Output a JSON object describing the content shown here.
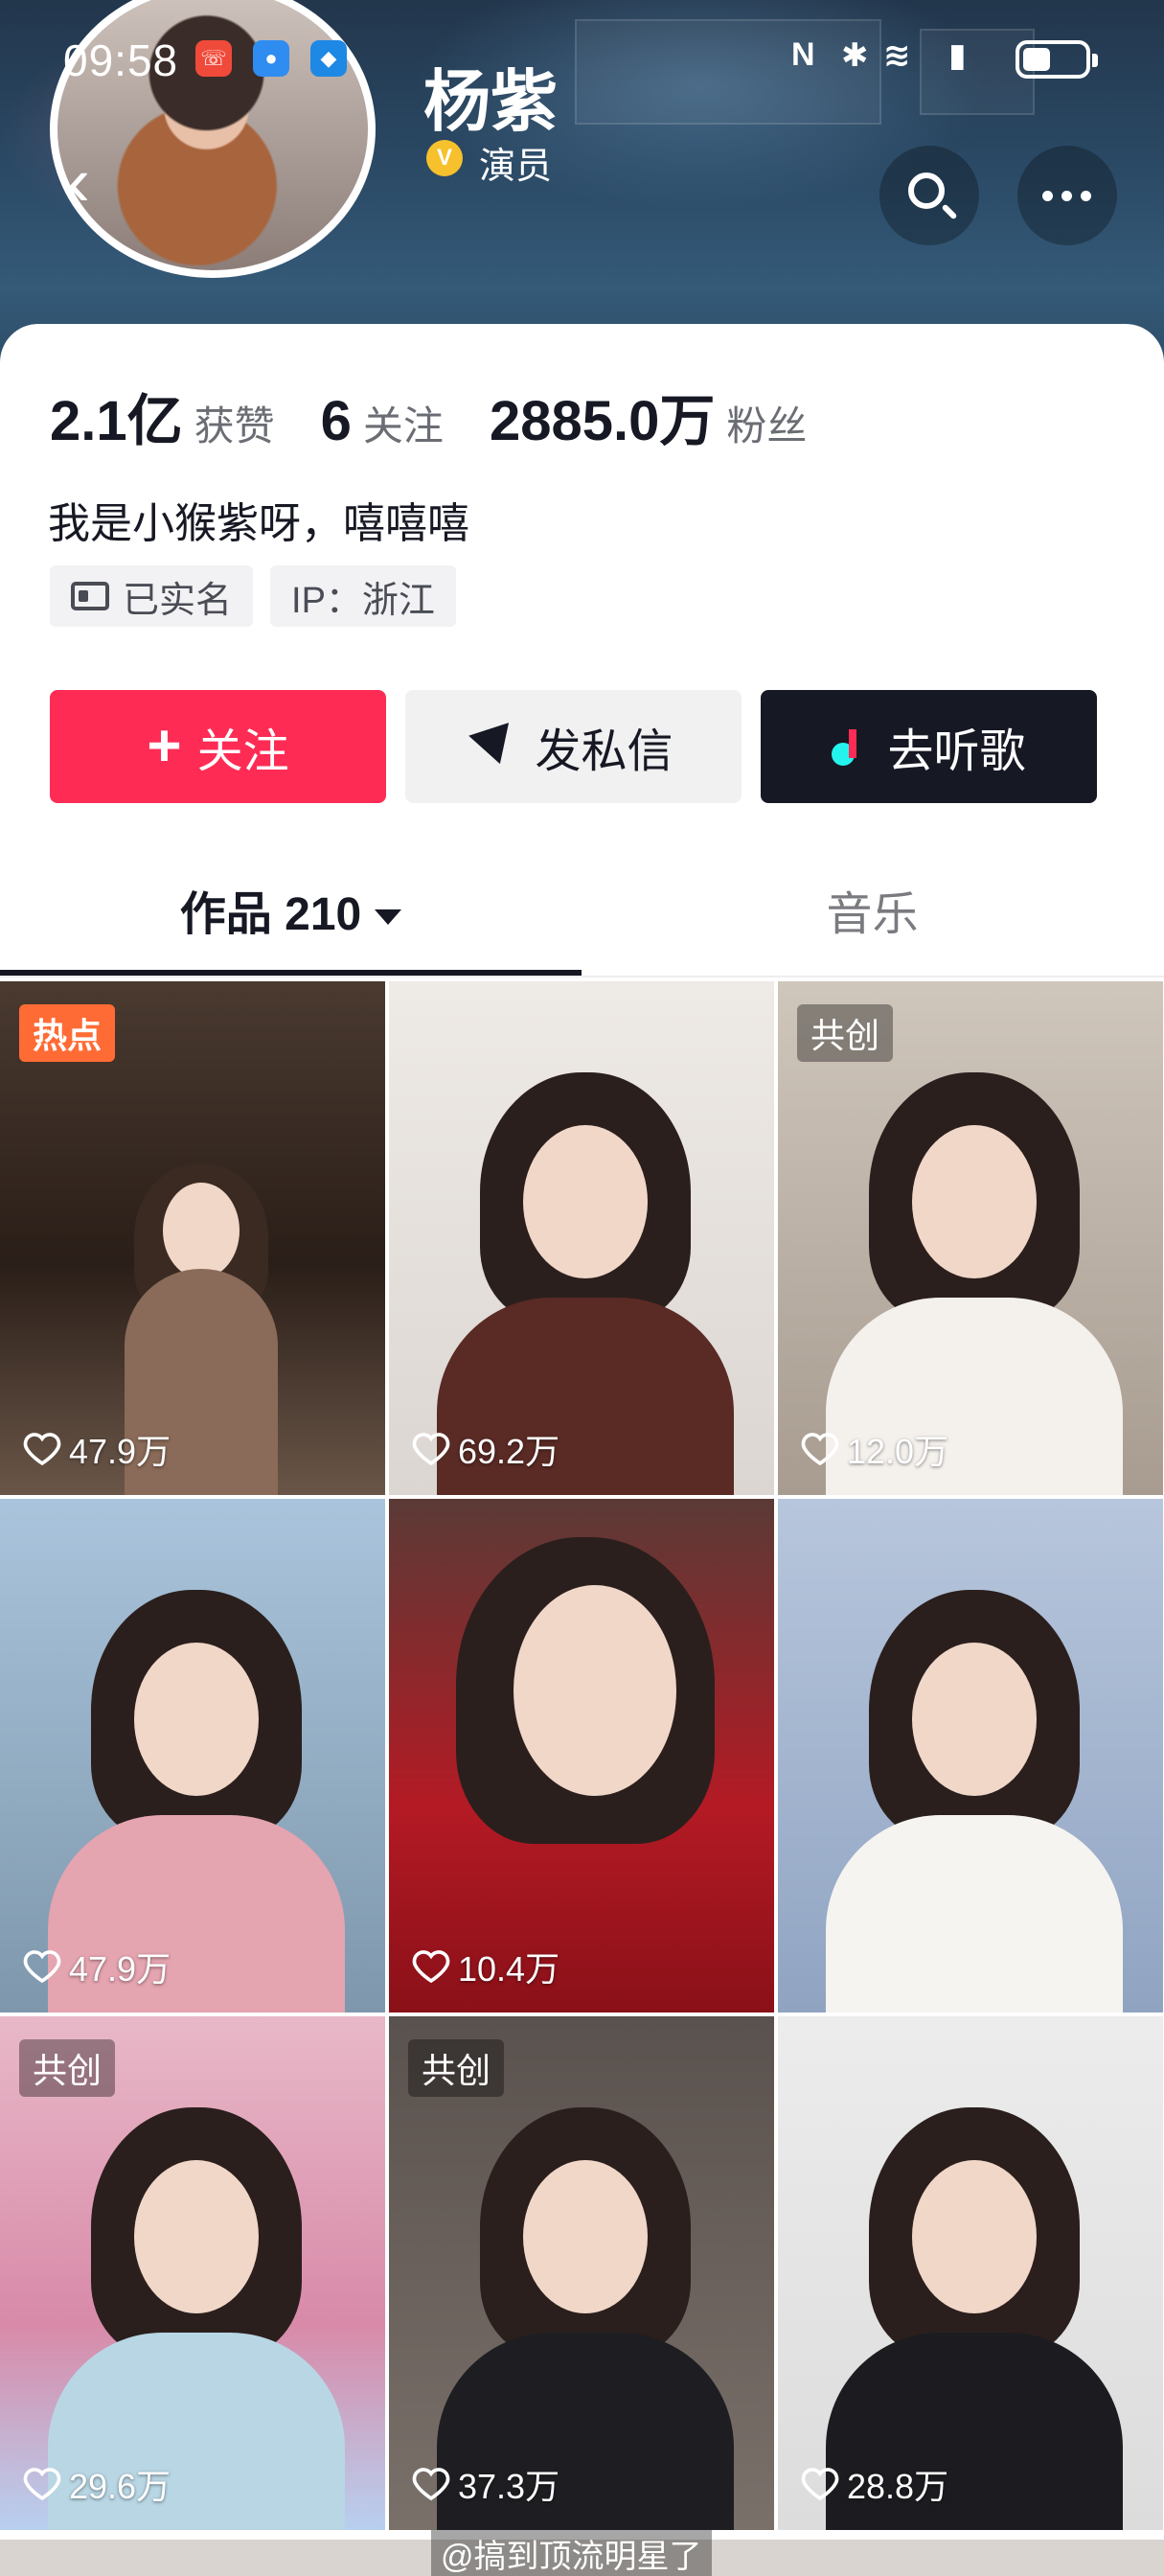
{
  "status_bar": {
    "time": "09:58",
    "battery_level": 0.45
  },
  "profile": {
    "name": "杨紫",
    "verified_badge": "V",
    "role": "演员",
    "bio": "我是小猴紫呀，嘻嘻嘻",
    "stats": [
      {
        "value": "2.1亿",
        "label": "获赞"
      },
      {
        "value": "6",
        "label": "关注"
      },
      {
        "value": "2885.0万",
        "label": "粉丝"
      }
    ],
    "tags": [
      "已实名",
      "IP：浙江"
    ]
  },
  "actions": {
    "follow_plus": "+",
    "follow": "关注",
    "message": "发私信",
    "music": "去听歌"
  },
  "tabs": {
    "works": "作品 210",
    "music": "音乐"
  },
  "videos": [
    {
      "badge": "热点",
      "likes": "47.9万"
    },
    {
      "badge": "",
      "likes": "69.2万"
    },
    {
      "badge": "共创",
      "likes": "12.0万"
    },
    {
      "badge": "",
      "likes": "47.9万"
    },
    {
      "badge": "",
      "likes": "10.4万"
    },
    {
      "badge": "",
      "likes": ""
    },
    {
      "badge": "共创",
      "likes": "29.6万"
    },
    {
      "badge": "共创",
      "likes": "37.3万"
    },
    {
      "badge": "",
      "likes": "28.8万"
    }
  ],
  "watermark": "@搞到顶流明星了",
  "colors": {
    "accent": "#fe2c55",
    "dark_button": "#161823",
    "hot_badge": "#ff6b35"
  }
}
